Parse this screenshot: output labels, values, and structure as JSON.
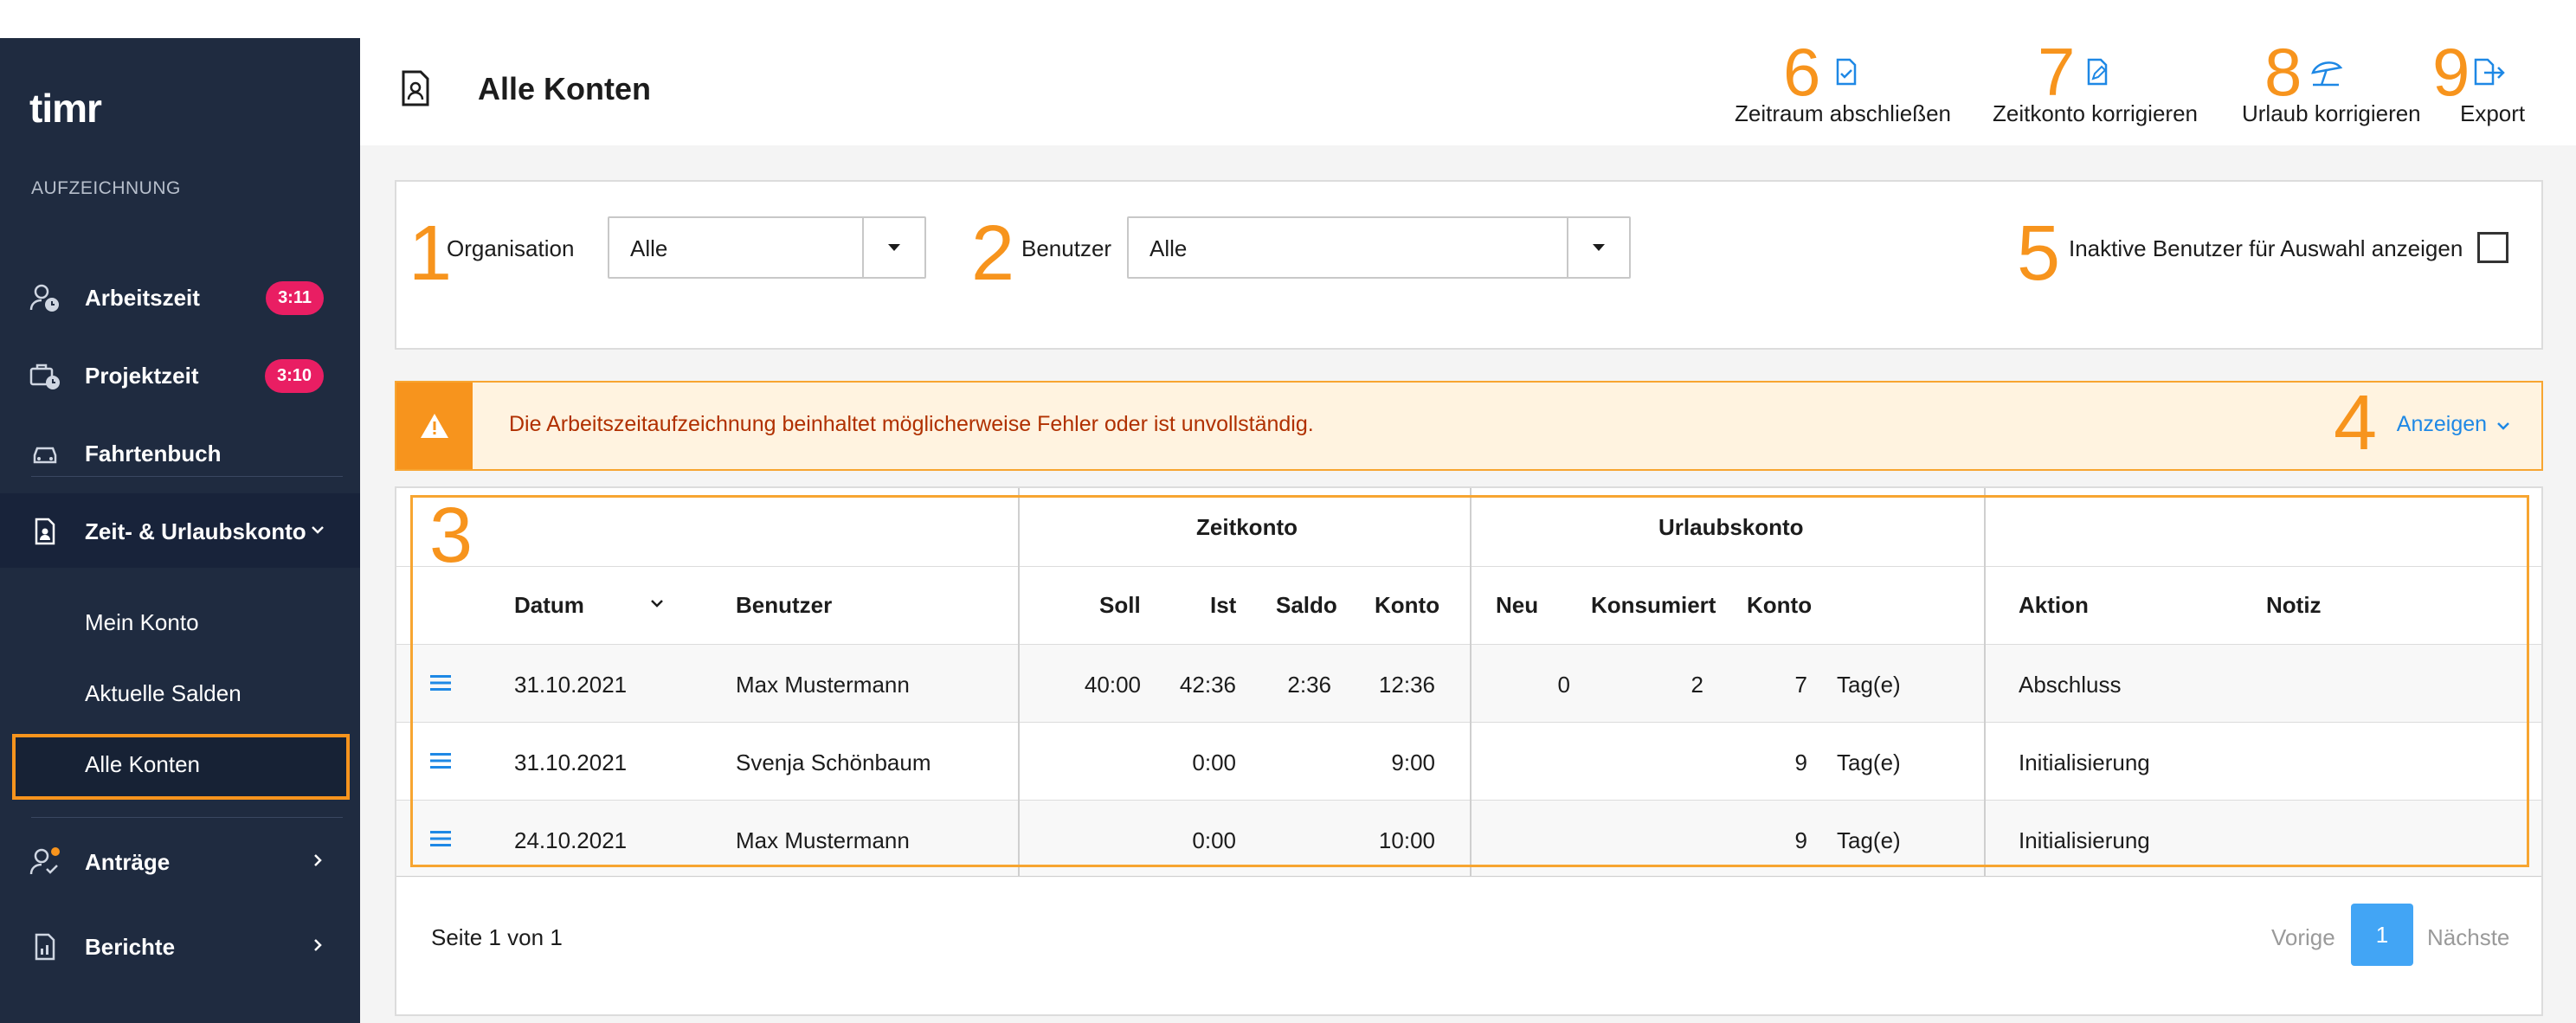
{
  "app": {
    "logo_text": "timr"
  },
  "sidebar": {
    "section_label": "AUFZEICHNUNG",
    "items": [
      {
        "label": "Arbeitszeit",
        "badge": "3:11",
        "icon": "user-clock-icon"
      },
      {
        "label": "Projektzeit",
        "badge": "3:10",
        "icon": "briefcase-clock-icon"
      },
      {
        "label": "Fahrtenbuch",
        "icon": "car-icon"
      },
      {
        "label": "Zeit- & Urlaubskonto",
        "icon": "document-user-icon",
        "expanded": true
      },
      {
        "label": "Anträge",
        "icon": "user-check-icon"
      },
      {
        "label": "Berichte",
        "icon": "report-icon"
      }
    ],
    "subitems": [
      "Mein Konto",
      "Aktuelle Salden",
      "Alle Konten"
    ],
    "active_subitem": "Alle Konten"
  },
  "header": {
    "title": "Alle Konten",
    "actions": [
      {
        "num": "6",
        "label": "Zeitraum abschließen",
        "icon": "document-check-icon"
      },
      {
        "num": "7",
        "label": "Zeitkonto korrigieren",
        "icon": "document-edit-icon"
      },
      {
        "num": "8",
        "label": "Urlaub korrigieren",
        "icon": "beach-umbrella-icon"
      },
      {
        "num": "9",
        "label": "Export",
        "icon": "export-icon"
      }
    ]
  },
  "filters": {
    "org_num": "1",
    "org_label": "Organisation",
    "org_value": "Alle",
    "user_num": "2",
    "user_label": "Benutzer",
    "user_value": "Alle",
    "inactive_num": "5",
    "inactive_label": "Inaktive Benutzer für Auswahl anzeigen",
    "inactive_checked": false
  },
  "alert": {
    "num": "4",
    "text": "Die Arbeitszeitaufzeichnung beinhaltet möglicherweise Fehler oder ist unvollständig.",
    "link": "Anzeigen"
  },
  "table": {
    "num": "3",
    "group_headers": {
      "zeitkonto": "Zeitkonto",
      "urlaubskonto": "Urlaubskonto"
    },
    "columns": {
      "datum": "Datum",
      "benutzer": "Benutzer",
      "soll": "Soll",
      "ist": "Ist",
      "saldo": "Saldo",
      "konto": "Konto",
      "neu": "Neu",
      "konsumiert": "Konsumiert",
      "ukonto": "Konto",
      "aktion": "Aktion",
      "notiz": "Notiz"
    },
    "rows": [
      {
        "datum": "31.10.2021",
        "benutzer": "Max Mustermann",
        "soll": "40:00",
        "ist": "42:36",
        "saldo": "2:36",
        "konto": "12:36",
        "neu": "0",
        "konsumiert": "2",
        "ukonto": "7",
        "unit": "Tag(e)",
        "aktion": "Abschluss",
        "notiz": ""
      },
      {
        "datum": "31.10.2021",
        "benutzer": "Svenja Schönbaum",
        "soll": "",
        "ist": "0:00",
        "saldo": "",
        "konto": "9:00",
        "neu": "",
        "konsumiert": "",
        "ukonto": "9",
        "unit": "Tag(e)",
        "aktion": "Initialisierung",
        "notiz": ""
      },
      {
        "datum": "24.10.2021",
        "benutzer": "Max Mustermann",
        "soll": "",
        "ist": "0:00",
        "saldo": "",
        "konto": "10:00",
        "neu": "",
        "konsumiert": "",
        "ukonto": "9",
        "unit": "Tag(e)",
        "aktion": "Initialisierung",
        "notiz": ""
      }
    ]
  },
  "pagination": {
    "info": "Seite 1 von 1",
    "prev": "Vorige",
    "current": "1",
    "next": "Nächste"
  },
  "colors": {
    "sidebar_bg": "#1f2b40",
    "accent_orange": "#f7941d",
    "badge_pink": "#e91e63",
    "link_blue": "#1e88e5"
  }
}
